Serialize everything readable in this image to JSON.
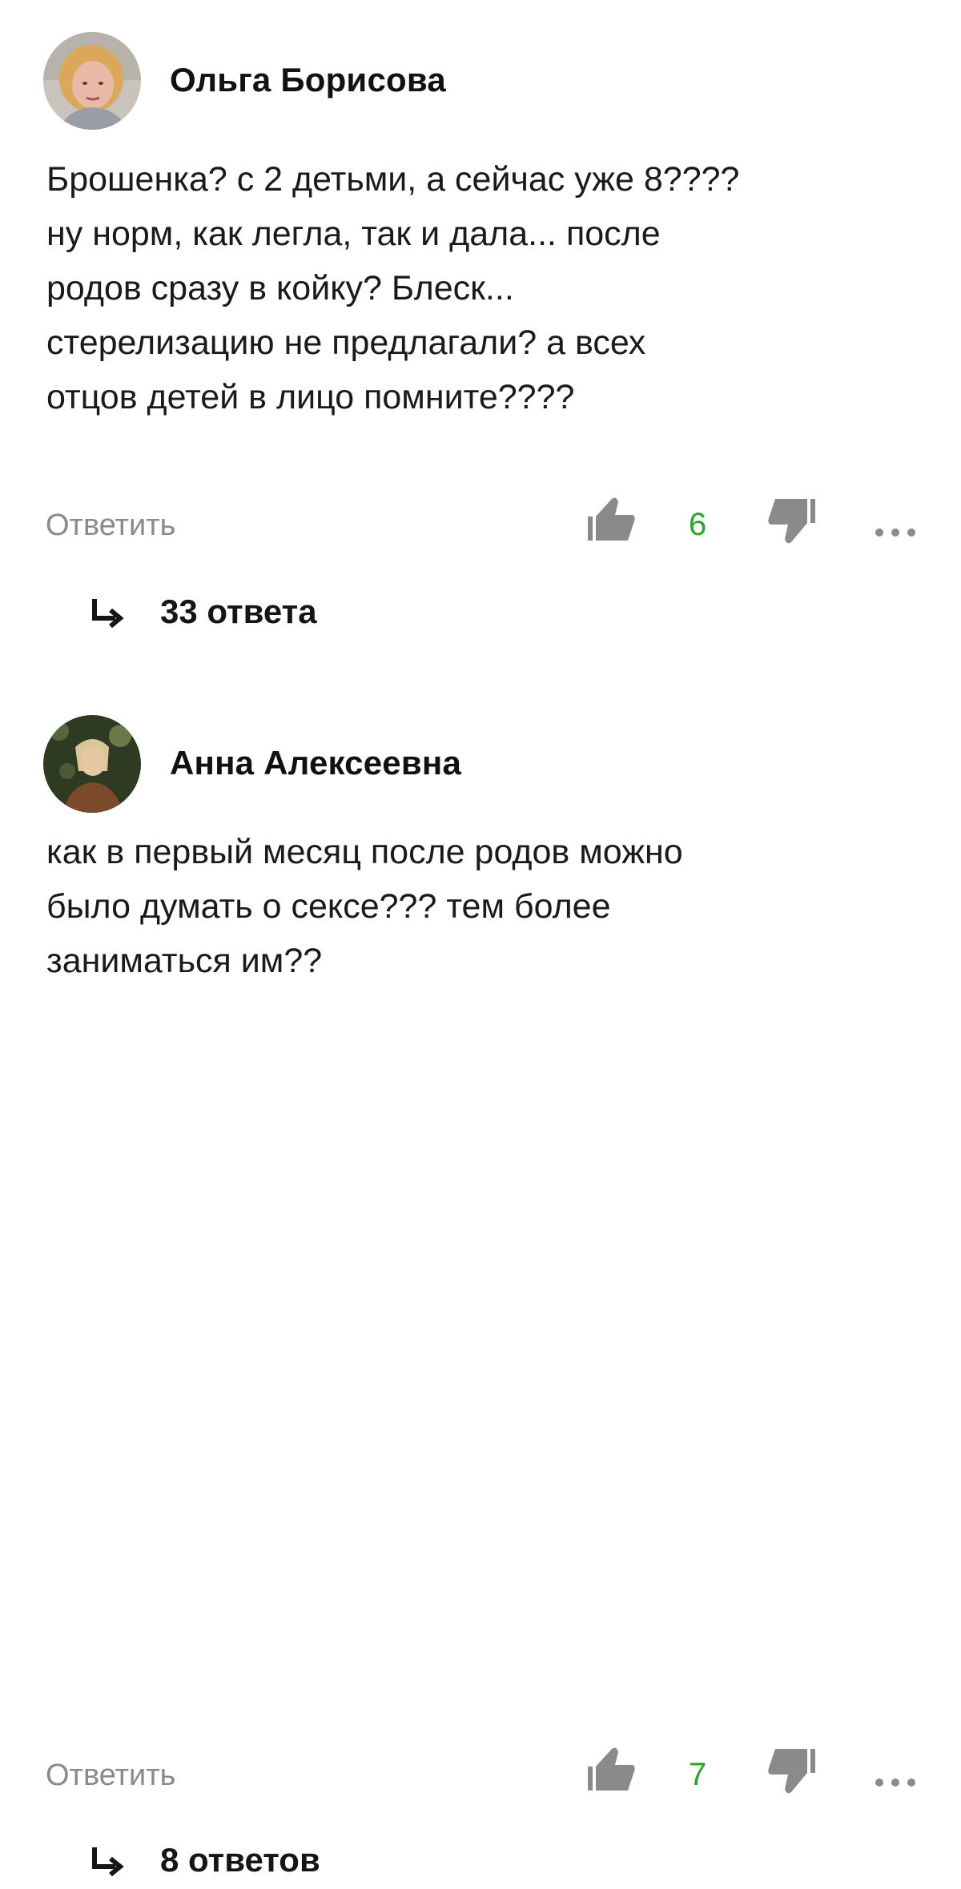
{
  "comments": [
    {
      "author": "Ольга Борисова",
      "text": "Брошенка? с 2 детьми, а сейчас уже 8????\nну норм, как легла, так и дала... после\nродов сразу в койку? Блеск...\nстерелизацию не предлагали? а всех\nотцов детей в лицо помните????",
      "reply_label": "Ответить",
      "likes": "6",
      "replies_label": "33 ответа"
    },
    {
      "author": "Анна Алексеевна",
      "text": "как в первый месяц после родов можно\nбыло думать о сексе??? тем более\nзаниматься им??",
      "reply_label": "Ответить",
      "likes": "7",
      "replies_label": "8 ответов"
    }
  ],
  "icons": {
    "like": "thumbs-up-icon",
    "dislike": "thumbs-down-icon",
    "more": "more-dots-icon",
    "replies": "reply-arrow-icon"
  },
  "colors": {
    "like_count": "#2aa52a",
    "muted": "#8a8a8a",
    "text": "#111111"
  }
}
